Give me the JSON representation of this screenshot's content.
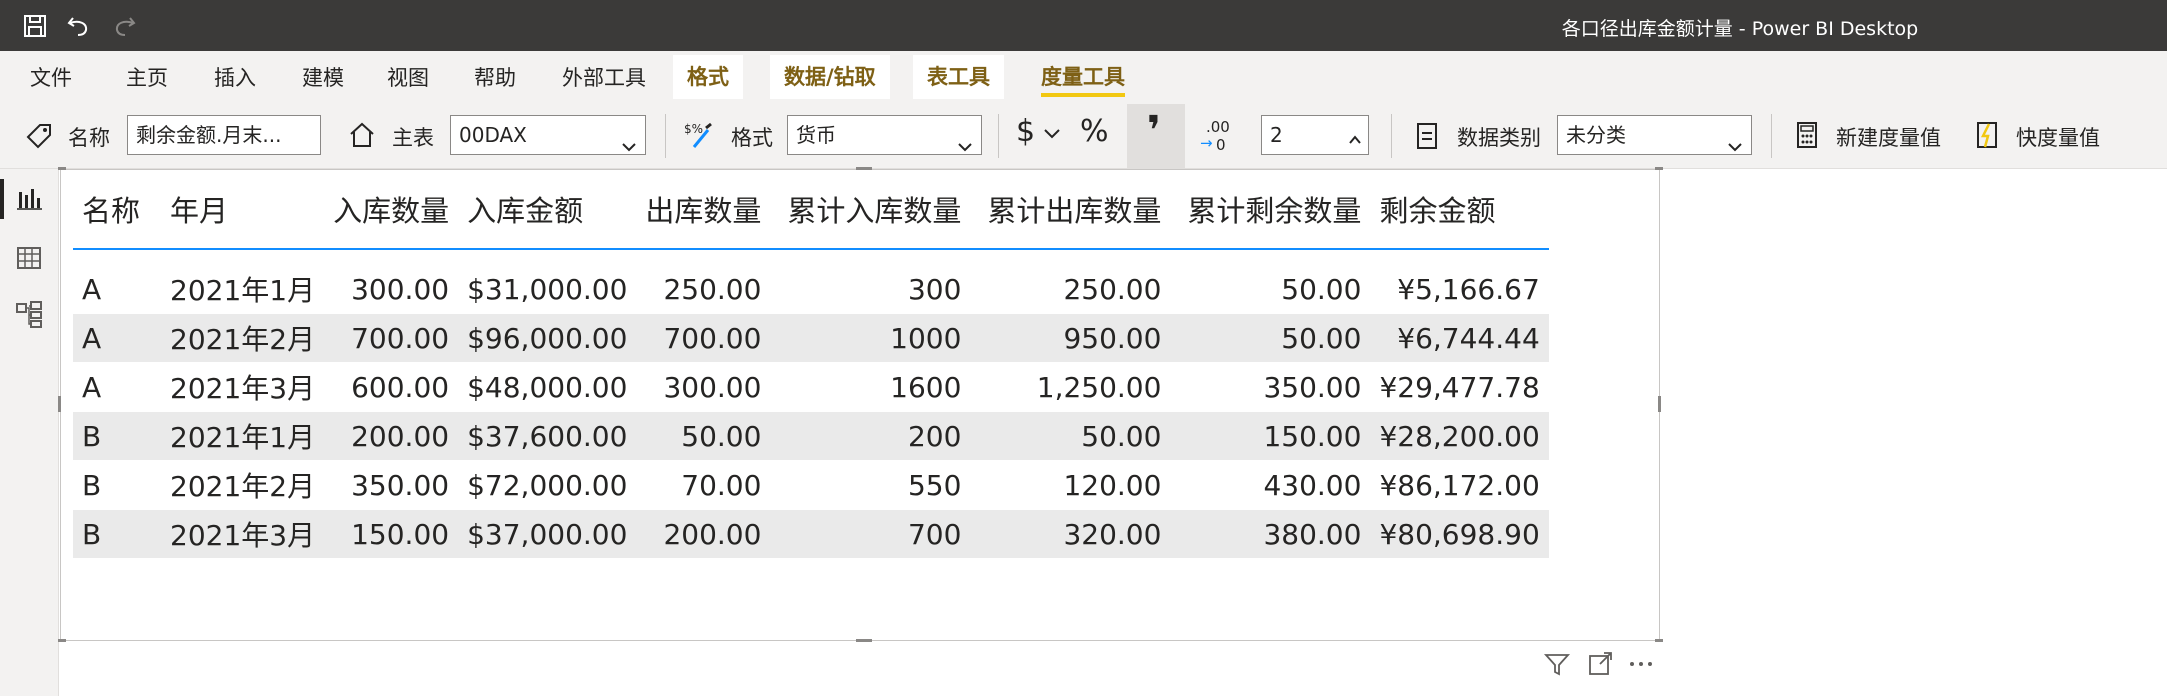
{
  "window": {
    "title": "各口径出库金额计量 - Power BI Desktop"
  },
  "tabs": [
    {
      "label": "文件"
    },
    {
      "label": "主页"
    },
    {
      "label": "插入"
    },
    {
      "label": "建模"
    },
    {
      "label": "视图"
    },
    {
      "label": "帮助"
    },
    {
      "label": "外部工具"
    },
    {
      "label": "格式"
    },
    {
      "label": "数据/钻取"
    },
    {
      "label": "表工具"
    },
    {
      "label": "度量工具"
    }
  ],
  "ribbon": {
    "name_label": "名称",
    "name_value": "剩余金额.月末...",
    "home_table_label": "主表",
    "home_table_value": "00DAX",
    "format_label": "格式",
    "format_value": "货币",
    "currency_symbol": "$",
    "percent_symbol": "%",
    "comma_symbol": "❜",
    "decimal_icon_text": ".00",
    "decimal_icon_sub": "0",
    "decimal_places": "2",
    "data_category_label": "数据类别",
    "data_category_value": "未分类",
    "new_measure_label": "新建度量值",
    "quick_measure_label": "快度量值"
  },
  "table": {
    "headers": [
      "名称",
      "年月",
      "入库数量",
      "入库金额",
      "出库数量",
      "累计入库数量",
      "累计出库数量",
      "累计剩余数量",
      "剩余金额"
    ],
    "rows": [
      [
        "A",
        "2021年1月",
        "300.00",
        "$31,000.00",
        "250.00",
        "300",
        "250.00",
        "50.00",
        "¥5,166.67"
      ],
      [
        "A",
        "2021年2月",
        "700.00",
        "$96,000.00",
        "700.00",
        "1000",
        "950.00",
        "50.00",
        "¥6,744.44"
      ],
      [
        "A",
        "2021年3月",
        "600.00",
        "$48,000.00",
        "300.00",
        "1600",
        "1,250.00",
        "350.00",
        "¥29,477.78"
      ],
      [
        "B",
        "2021年1月",
        "200.00",
        "$37,600.00",
        "50.00",
        "200",
        "50.00",
        "150.00",
        "¥28,200.00"
      ],
      [
        "B",
        "2021年2月",
        "350.00",
        "$72,000.00",
        "70.00",
        "550",
        "120.00",
        "430.00",
        "¥86,172.00"
      ],
      [
        "B",
        "2021年3月",
        "150.00",
        "$37,000.00",
        "200.00",
        "700",
        "320.00",
        "380.00",
        "¥80,698.90"
      ]
    ]
  },
  "colors": {
    "titlebar": "#3b3a39",
    "ribbon": "#f3f2f1",
    "context_tab_text": "#7e6015",
    "active_underline": "#f2c811",
    "header_rule": "#118dff",
    "row_alt": "#eaeaea"
  }
}
